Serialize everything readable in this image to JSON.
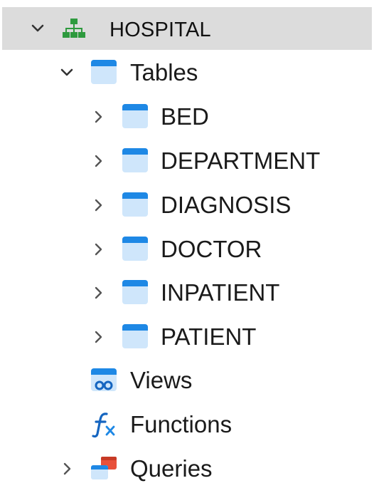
{
  "tree": {
    "root": {
      "label": "HOSPITAL",
      "icon": "database-connection-icon",
      "expanded": true,
      "selected": true
    },
    "tables_group": {
      "label": "Tables",
      "icon": "table-folder-icon",
      "expanded": true
    },
    "tables": [
      {
        "label": "BED",
        "icon": "table-icon"
      },
      {
        "label": "DEPARTMENT",
        "icon": "table-icon"
      },
      {
        "label": "DIAGNOSIS",
        "icon": "table-icon"
      },
      {
        "label": "DOCTOR",
        "icon": "table-icon"
      },
      {
        "label": "INPATIENT",
        "icon": "table-icon"
      },
      {
        "label": "PATIENT",
        "icon": "table-icon"
      }
    ],
    "views": {
      "label": "Views",
      "icon": "views-icon"
    },
    "functions": {
      "label": "Functions",
      "icon": "function-icon"
    },
    "queries": {
      "label": "Queries",
      "icon": "queries-icon",
      "expanded": false
    }
  },
  "colors": {
    "selection_bg": "#dcdcdc",
    "table_icon_blue": "#1e88e5",
    "table_icon_light": "#cfe6fb",
    "db_icon_green": "#2e9a3e",
    "function_icon_blue": "#1565c0",
    "queries_icon_red": "#e8503a"
  }
}
